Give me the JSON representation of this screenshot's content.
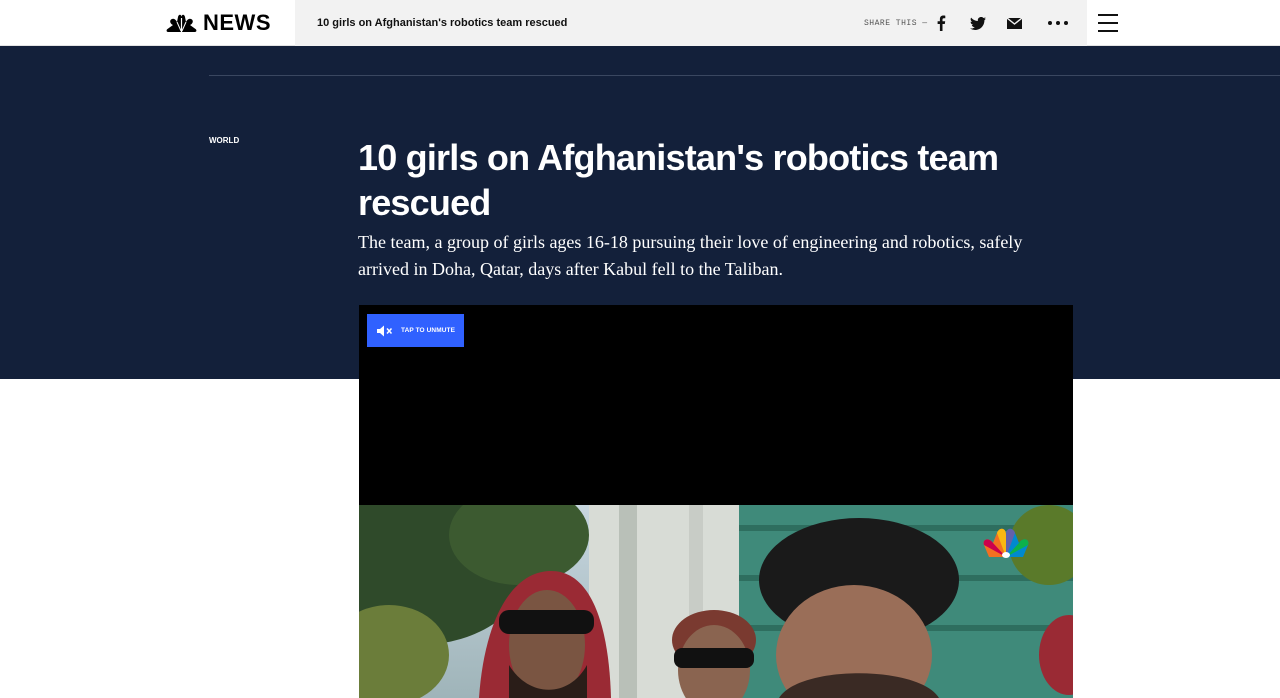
{
  "header": {
    "brand": "NEWS",
    "sticky_title": "10 girls on Afghanistan's robotics team rescued",
    "share_label": "SHARE THIS —",
    "share_icons": [
      "facebook-icon",
      "twitter-icon",
      "email-icon",
      "more-icon"
    ],
    "menu_icon": "hamburger-menu-icon"
  },
  "article": {
    "section": "WORLD",
    "headline": "10 girls on Afghanistan's robotics team rescued",
    "dek": "The team, a group of girls ages 16-18 pursuing their love of engineering and robotics, safely arrived in Doha, Qatar, days after Kabul fell to the Taliban."
  },
  "video": {
    "unmute_label": "TAP TO UNMUTE",
    "unmute_icon": "muted-speaker-icon",
    "watermark": "nbc-peacock-icon"
  },
  "colors": {
    "hero_bg": "#13203a",
    "unmute_bg": "#3061ff",
    "sticky_bg": "#f2f2f2"
  }
}
